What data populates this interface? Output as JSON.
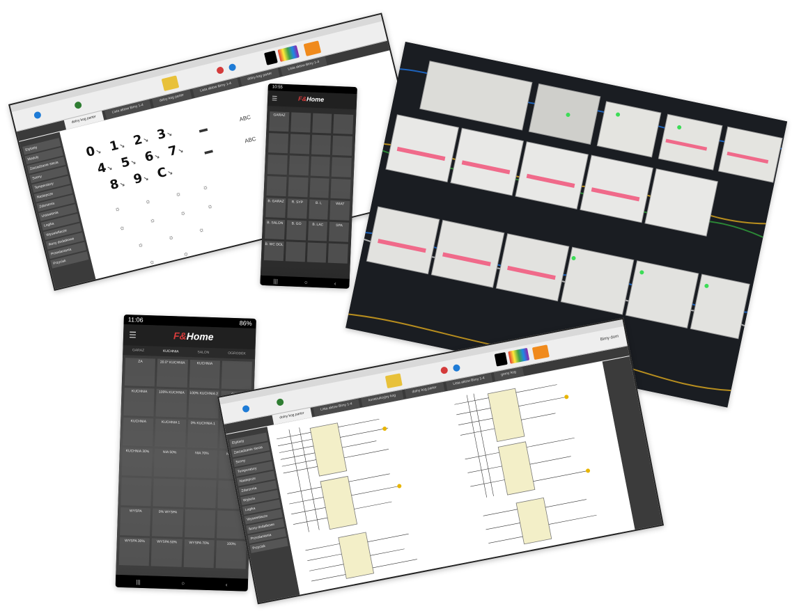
{
  "window_top": {
    "tabs": [
      "dolny kog parter",
      "Lista aktow Bimy 1-4",
      "dolny kog parter",
      "Lista aktow Bimy 1-4",
      "dolny kog parter",
      "Lista aktow Bimy 1-4"
    ],
    "sidebar": [
      "Etykiety",
      "Moduly",
      "Zarzadzanie siecia",
      "Sceny",
      "Temperatury",
      "Nastepcze",
      "Zdarzenia",
      "Ustawienia",
      "Logika",
      "Wyswietlacze",
      "Ikony dodatkowe",
      "Przeslaniania",
      "Przycisk"
    ],
    "digits": [
      "0",
      "1",
      "2",
      "3",
      "4",
      "5",
      "6",
      "7",
      "8",
      "9",
      "C"
    ],
    "abc_labels": [
      "ABC",
      "ABC",
      "V"
    ]
  },
  "phone_small": {
    "status_time": "10:55",
    "tiles": [
      "GARAZ",
      "",
      "",
      "",
      "",
      "",
      "",
      "",
      "",
      "",
      "",
      "",
      "",
      "",
      "",
      "",
      "B. GARAZ",
      "R. SYP",
      "B. L",
      "WIAT",
      "B. SALON",
      "B. GO",
      "B. LAC",
      "SPA",
      "B. WC DOL",
      "",
      "",
      ""
    ]
  },
  "phone_big": {
    "status_time": "11:06",
    "battery": "86%",
    "tabs": [
      "GARAZ",
      "KUCHNIA",
      "SALON",
      "OGRODEK"
    ],
    "tiles": [
      "ZA",
      "20.0° KUCHNIA",
      "KUCHNIA",
      "",
      "KUCHNIA",
      "100% KUCHNIA",
      "100% KUCHNIA 2",
      "OKAP",
      "KUCHNIA",
      "KUCHNIA 1",
      "0% KUCHNIA 1",
      "KUCHNIA 2",
      "KUCHNIA 30%",
      "NIA 50%",
      "NIA 70%",
      "NIA 100%",
      "",
      "",
      "",
      "",
      "WYSPA",
      "0% WYSPA",
      "",
      "",
      "WYSPA 30%",
      "WYSPA 50%",
      "WYSPA 70%",
      "100%"
    ]
  },
  "window_bottom": {
    "tabs": [
      "dolny kog parter",
      "Lista aktow Bimy 1-4",
      "konstrukcyjny kog",
      "dolny kog parter",
      "Lista aktow Bimy 1-4",
      "gorny kog"
    ],
    "sidebar": [
      "Etykiety",
      "Zarzadzanie siecia",
      "Sceny",
      "Temperatury",
      "Nastepcze",
      "Zdarzenia",
      "Wyjscia",
      "Logika",
      "Wyswietlacze",
      "Ikony dodatkowe",
      "Przeslaniania",
      "Przycisk"
    ],
    "ribbon_label": "Bimy dom"
  },
  "logo": {
    "prefix": "F&",
    "main": "Home"
  },
  "colors": {
    "window_frame": "#222222",
    "sidebar": "#3b3b3b",
    "accent_red": "#d43b3b",
    "accent_blue": "#1e7bd6",
    "module_pink": "#f06a8a"
  }
}
